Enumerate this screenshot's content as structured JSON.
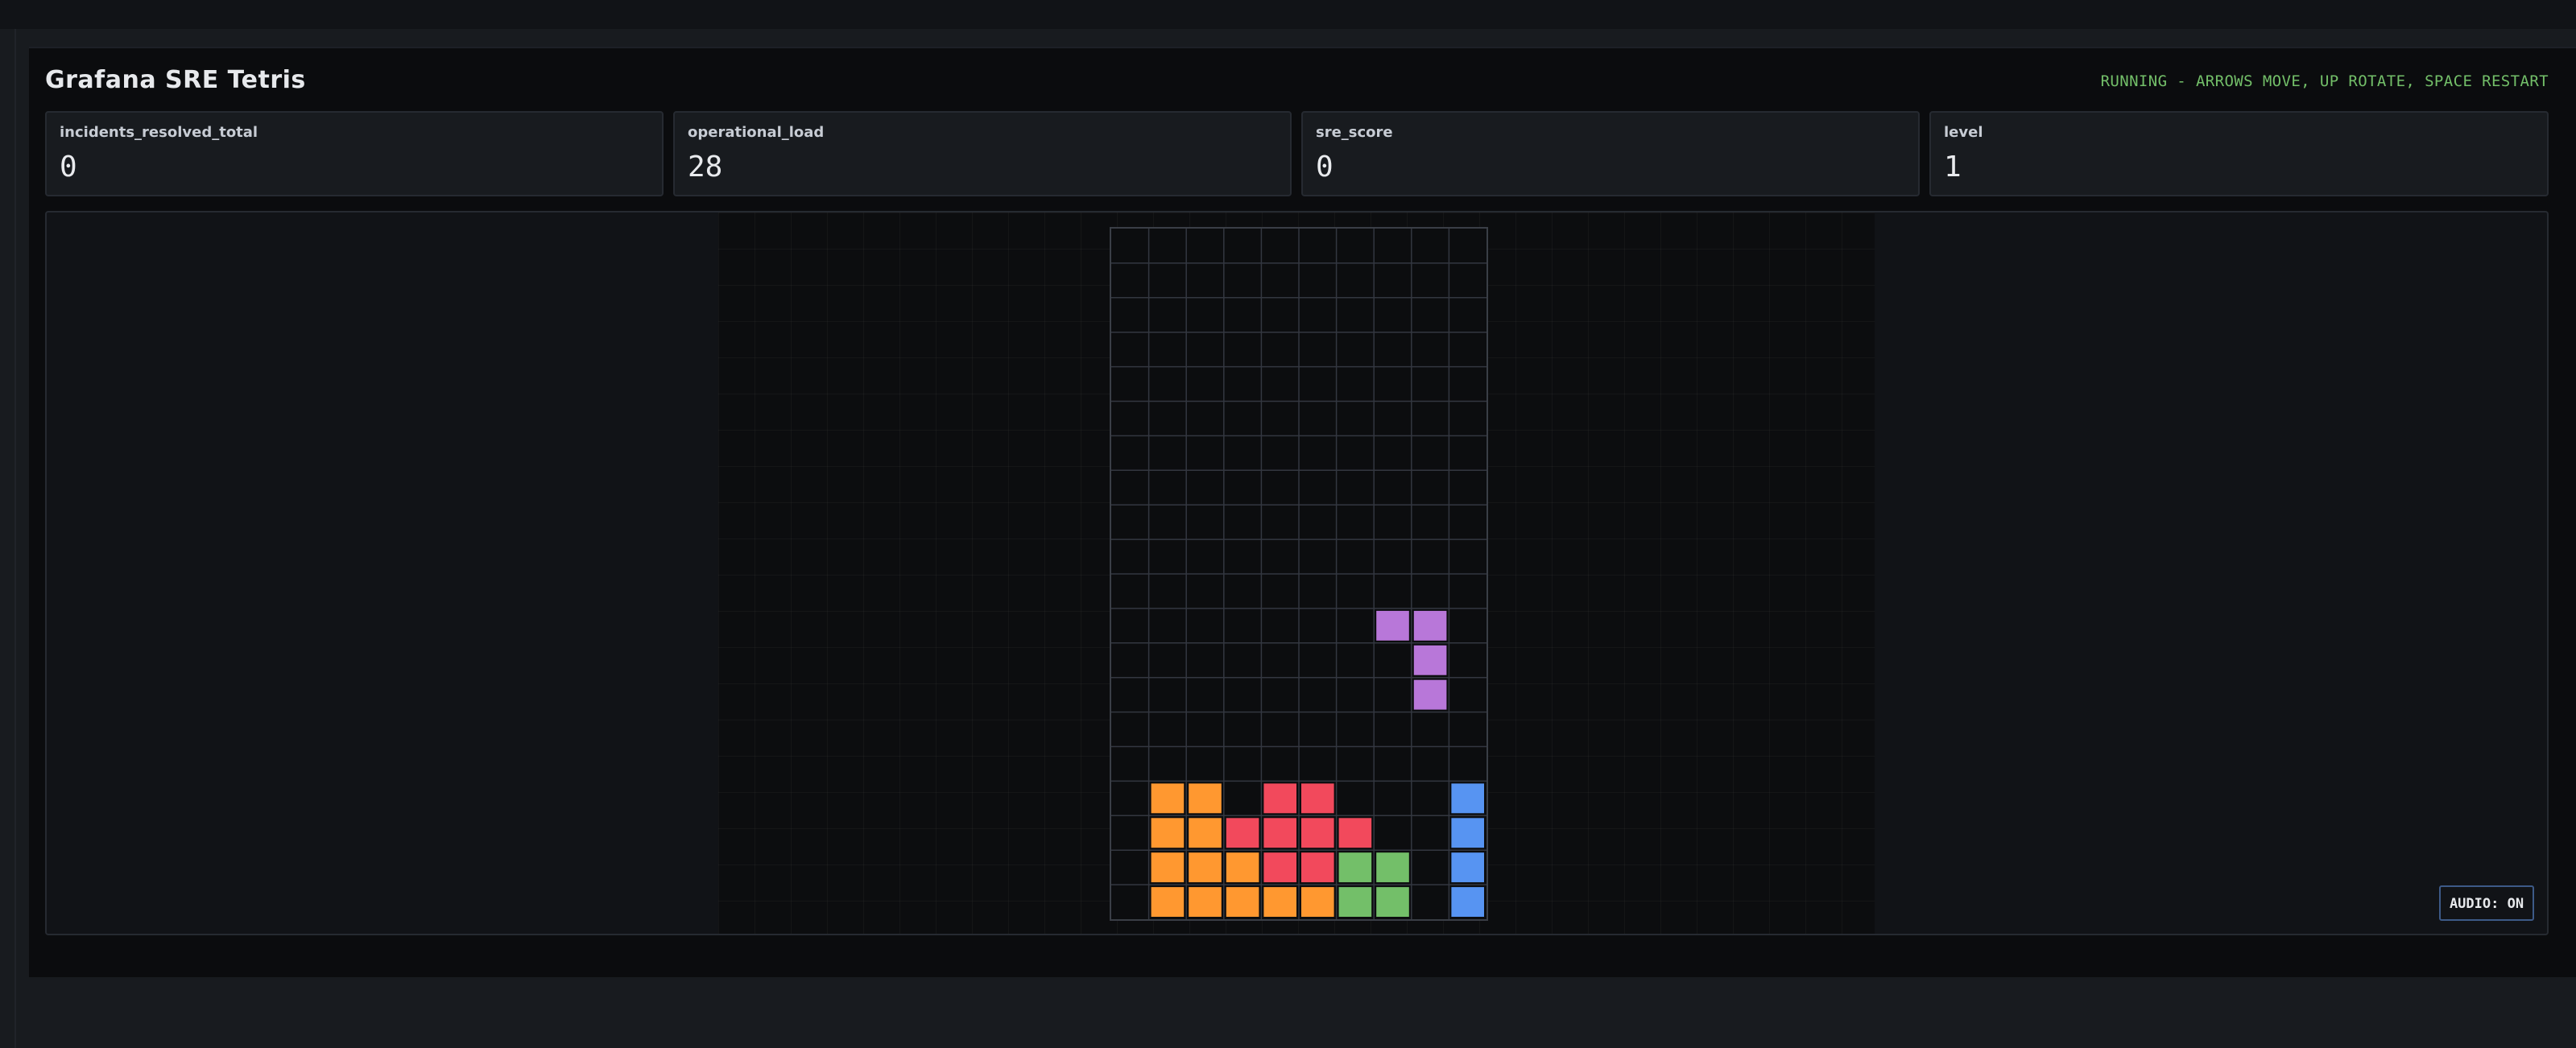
{
  "header": {
    "title": "Grafana SRE Tetris",
    "status": "RUNNING - ARROWS MOVE, UP ROTATE, SPACE RESTART"
  },
  "stats": [
    {
      "label": "incidents_resolved_total",
      "value": "0"
    },
    {
      "label": "operational_load",
      "value": "28"
    },
    {
      "label": "sre_score",
      "value": "0"
    },
    {
      "label": "level",
      "value": "1"
    }
  ],
  "board": {
    "columns": 10,
    "rows": 20,
    "colors": {
      "O": "#ff9830",
      "R": "#f2495c",
      "G": "#73bf69",
      "B": "#5794f2",
      "P": "#b877d9",
      "grid": "#333740",
      "background": "#0c0d0f"
    },
    "cells": [
      "..........",
      "..........",
      "..........",
      "..........",
      "..........",
      "..........",
      "..........",
      "..........",
      "..........",
      "..........",
      "..........",
      "..........",
      "..........",
      "..........",
      "..........",
      "..........",
      ".OO.RR...B",
      ".OORRRR..B",
      ".OOORRGG.B",
      ".OOOOOGG.B"
    ],
    "active_piece": {
      "type": "J",
      "color": "#b877d9",
      "cells": [
        [
          7,
          11
        ],
        [
          8,
          11
        ],
        [
          8,
          12
        ],
        [
          8,
          13
        ]
      ]
    }
  },
  "audio": {
    "label": "AUDIO: ON"
  }
}
